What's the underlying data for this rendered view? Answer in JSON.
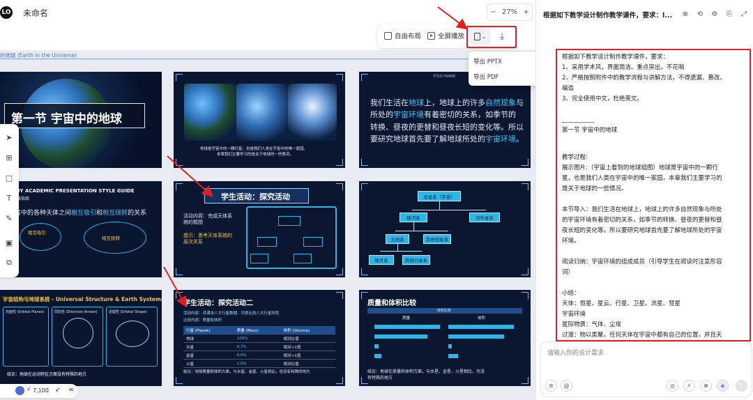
{
  "app": {
    "logo_text": "LO",
    "doc_title": "未命名",
    "zoom_minus": "−",
    "zoom_value": "27%",
    "zoom_plus": "+"
  },
  "toolbar": {
    "free_layout": "自由布局",
    "fullscreen_play": "全屏播放",
    "export_chevron": "⌄",
    "download_icon": "⤓"
  },
  "export_menu": {
    "items": [
      "导出 PPTX",
      "导出 PDF"
    ]
  },
  "canvas": {
    "breadcrumb": "的地球 (Earth in the Universe)"
  },
  "slides": {
    "s1_title": "第一节 宇宙中的地球",
    "s2_caption1": "地球是宇宙中的一颗行星，也是我们人类在宇宙中的唯一家园。",
    "s2_caption2": "本章我们主要学习的是关于地球的一些情况。",
    "s3_tag": "TITLE FRAME",
    "s3_line1_a": "我们生活在",
    "s3_line1_b": "地球",
    "s3_line1_c": "上，地球上的许多",
    "s3_line1_d": "自然现象",
    "s3_line1_e": "与",
    "s3_line2_a": "所处的",
    "s3_line2_b": "宇宙环境",
    "s3_line2_c": "有着密切的关系，如季节的",
    "s3_line3": "转换、昼夜的更替和昼夜长短的变化等。所以",
    "s3_line4_a": "要研究地球首先要了解地球所处的",
    "s3_line4_b": "宇宙环境",
    "s3_line4_c": "。",
    "s4_title1": "APHY ACADEMIC PRESENTATION STYLE GUIDE",
    "s4_title2": "告风格指南",
    "s4_sub_a": "宇宙中的各种天体之间",
    "s4_sub_b": "相互吸引",
    "s4_sub_c": "和",
    "s4_sub_d": "相互绕转",
    "s4_sub_e": "的关系",
    "s4_label1": "相互吸引",
    "s4_label2": "相互绕转",
    "s5_title": "学生活动：探究活动",
    "s5_content1": "活动内容：完成天体系",
    "s5_content2": "统的框图",
    "s5_hint1": "提示：思考天体系统的",
    "s5_hint2": "层次关系",
    "s6_nodes": [
      "总星系（宇宙）",
      "银河系",
      "河外星系",
      "太阳系",
      "其他恒星系",
      "地月系",
      "其他行星系"
    ],
    "s7_title": "宇宙结构与地球系统 - Universal Structure & Earth Systems",
    "s7_col1": "共面性 (Orbital Planes)",
    "s7_col2": "同向性 (Direction Arrows)",
    "s7_col3": "近圆性 (Orbital Shape)",
    "s7_footer": "结论：地球在运动特征方面没有特殊的地方",
    "s8_title": "学生活动：探究活动二",
    "s8_content": "活动内容：读课本八大行星数据，列表比较八大行星特性",
    "s8_compare": "比较内容：质量和体积",
    "s8_table_header": [
      "行星 (Planet)",
      "质量 (Mass)",
      "体积 (Volume)"
    ],
    "s8_table_rows": [
      [
        "地球",
        "100%",
        "相对比值"
      ],
      [
        "水星",
        "0.7%",
        "相对<1值"
      ],
      [
        "金星",
        "0.6%",
        "相对<1值"
      ],
      [
        "火星",
        "1.6%",
        "相对比值"
      ]
    ],
    "s8_conclusion": "结论：地球质量和体积方面，与水星、金星、火星相比，也没有特殊的地方",
    "s9_title": "质量和体积比较",
    "s9_chart_head": "体积比较",
    "s9_col1": "质量",
    "s9_col2": "体积",
    "s9_conclusion1": "结论：地球在质量和体积方面，与水星、金星、火星相比，也没",
    "s9_conclusion2": "有特殊的地方"
  },
  "bottom_bar": {
    "credits": "7,100",
    "infinity": "∞"
  },
  "chat": {
    "header": "根据如下教学设计制作教学课件，要求：l...",
    "lines": [
      "根据如下教学设计制作教学课件，要求：",
      "1、采用学术风，界面简洁、重点突出，不花哨",
      "2、严格按照附件中的教学流程与讲解方法，不得遗漏、篡改、",
      "编造",
      "3、完全使用中文，杜绝英文。",
      "",
      "___________",
      "第一节 宇宙中的地球",
      "",
      "",
      "教学过程:",
      "展示图片:（宇宙上看到的地球组图）地球是宇宙中的一颗行",
      "星，也是我们人类在宇宙中的唯一家园，本章我们主要学习的",
      "是关于地球的一些情况。",
      "",
      "本节导入：我们生活在地球上，地球上的许多自然现象与所处",
      "的宇宙环境有着密切的关系，如季节的转换、昼夜的更替和昼",
      "夜长短的变化等。所以要研究地球首先要了解地球所处的宇宙",
      "环境。",
      "",
      "阅读归纳：宇宙环境的组成成员（引导学生在阅读时注意形容",
      "词）",
      "",
      "小结：",
      "天体：恒星、星云、行星、卫星、流星、彗星",
      "宇宙环境",
      "星际物质：气体、尘埃",
      "过渡：物以类聚，任何天体在宇宙中都有自己的位置，并且天"
    ],
    "input_placeholder": "请输入你的设计需求"
  }
}
